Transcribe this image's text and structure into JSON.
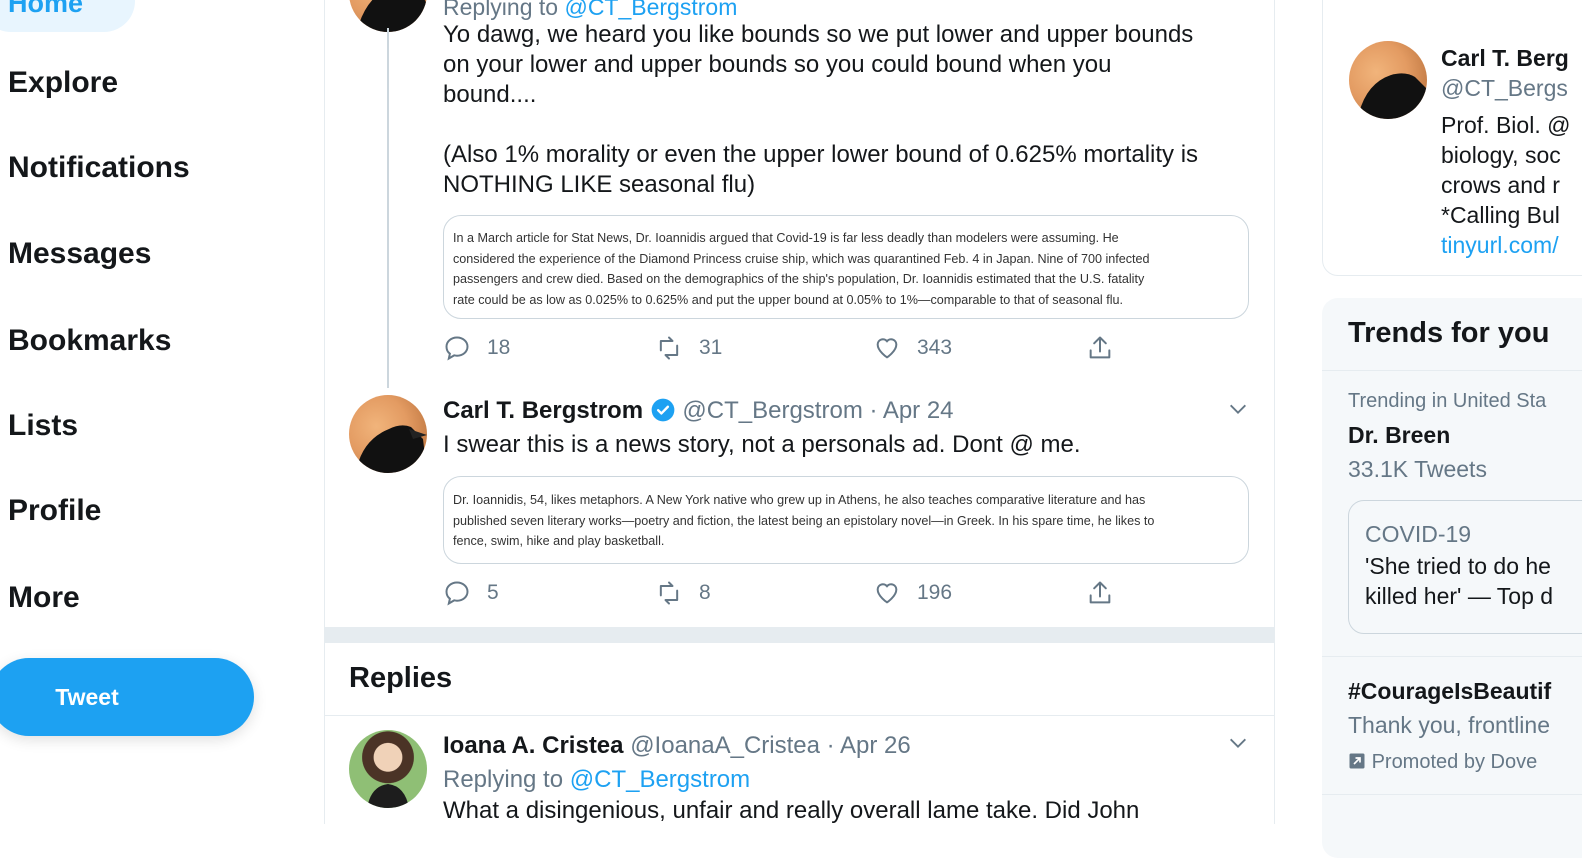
{
  "nav": {
    "home": "Home",
    "items": [
      "Explore",
      "Notifications",
      "Messages",
      "Bookmarks",
      "Lists",
      "Profile",
      "More"
    ],
    "tweet_button": "Tweet"
  },
  "tweet1": {
    "replying_prefix": "Replying to",
    "replying_handle": "@CT_Bergstrom",
    "text_lines": [
      "Yo dawg, we heard you like bounds so we put lower and upper bounds",
      "on your lower and upper bounds so you could bound when you",
      "bound....",
      "",
      "(Also 1% morality or even the upper lower bound of 0.625% mortality is",
      "NOTHING LIKE seasonal flu)"
    ],
    "quote_lines": [
      "In a March article for Stat News, Dr. Ioannidis argued that Covid-19 is far less deadly than modelers were assuming. He",
      "considered the experience of the Diamond Princess cruise ship, which was quarantined Feb. 4 in Japan. Nine of 700 infected",
      "passengers and crew died. Based on the demographics of the ship's population, Dr. Ioannidis estimated that the U.S. fatality",
      "rate could be as low as 0.025% to 0.625% and put the upper bound at 0.05% to 1%—comparable to that of seasonal flu."
    ],
    "replies": "18",
    "retweets": "31",
    "likes": "343"
  },
  "tweet2": {
    "name": "Carl T. Bergstrom",
    "handle": "@CT_Bergstrom",
    "date": "· Apr 24",
    "text": "I swear this is a news story, not a personals ad. Dont @ me.",
    "quote_lines": [
      "Dr. Ioannidis, 54, likes metaphors. A New York native who grew up in Athens, he also teaches comparative literature and has",
      "published seven literary works—poetry and fiction, the latest being an epistolary novel—in Greek. In his spare time, he likes to",
      "fence, swim, hike and play basketball."
    ],
    "replies": "5",
    "retweets": "8",
    "likes": "196"
  },
  "replies_section": {
    "title": "Replies",
    "reply": {
      "name": "Ioana A. Cristea",
      "handle": "@IoanaA_Cristea",
      "date": "· Apr 26",
      "replying_prefix": "Replying to",
      "replying_handle": "@CT_Bergstrom",
      "text": "What a disingenious, unfair and really overall lame take. Did John"
    }
  },
  "right": {
    "profile": {
      "name": "Carl T. Berg",
      "handle": "@CT_Bergs",
      "bio_lines": [
        "Prof. Biol. @",
        "biology, soc",
        "crows and r",
        "*Calling Bul"
      ],
      "link": "tinyurl.com/"
    },
    "trends": {
      "title": "Trends for you",
      "trend1_context": "Trending in United Sta",
      "trend1_name": "Dr. Breen",
      "trend1_count": "33.1K Tweets",
      "card_topic": "COVID-19",
      "card_text_1": "'She tried to do he",
      "card_text_2": "killed her' — Top d",
      "trend2_name": "#CourageIsBeautif",
      "trend2_text": "Thank you, frontline",
      "promoted": "Promoted by Dove"
    }
  },
  "colors": {
    "accent": "#1da1f2",
    "muted": "#657786",
    "border": "#e6ecf0"
  }
}
